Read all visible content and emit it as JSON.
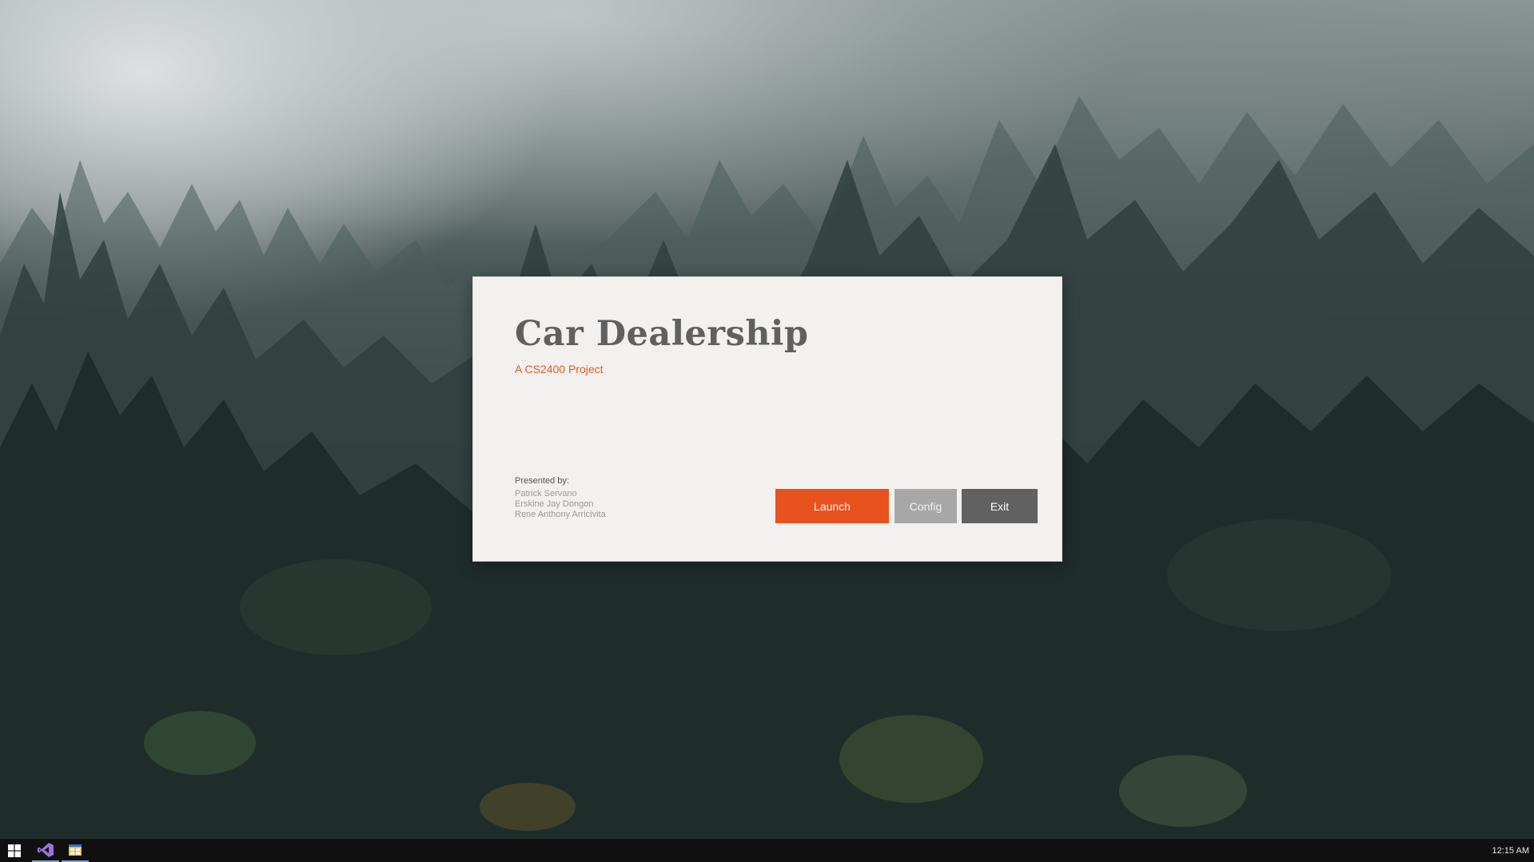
{
  "dialog": {
    "title": "Car Dealership",
    "subtitle": "A CS2400 Project",
    "credits": {
      "heading": "Presented by:",
      "names": [
        "Patrick Servano",
        "Erskine Jay Dongon",
        "Rene Anthony Arricivita"
      ]
    },
    "buttons": {
      "launch": "Launch",
      "config": "Config",
      "exit": "Exit"
    }
  },
  "taskbar": {
    "clock": "12:15 AM",
    "icons": [
      "windows-start-icon",
      "visual-studio-icon",
      "app-window-icon"
    ]
  },
  "colors": {
    "accent": "#e8521e",
    "dialog_background": "#f2f1f0",
    "title_text": "#606060",
    "config_button": "#a7a7a7",
    "exit_button": "#616161",
    "taskbar": "#101010"
  }
}
